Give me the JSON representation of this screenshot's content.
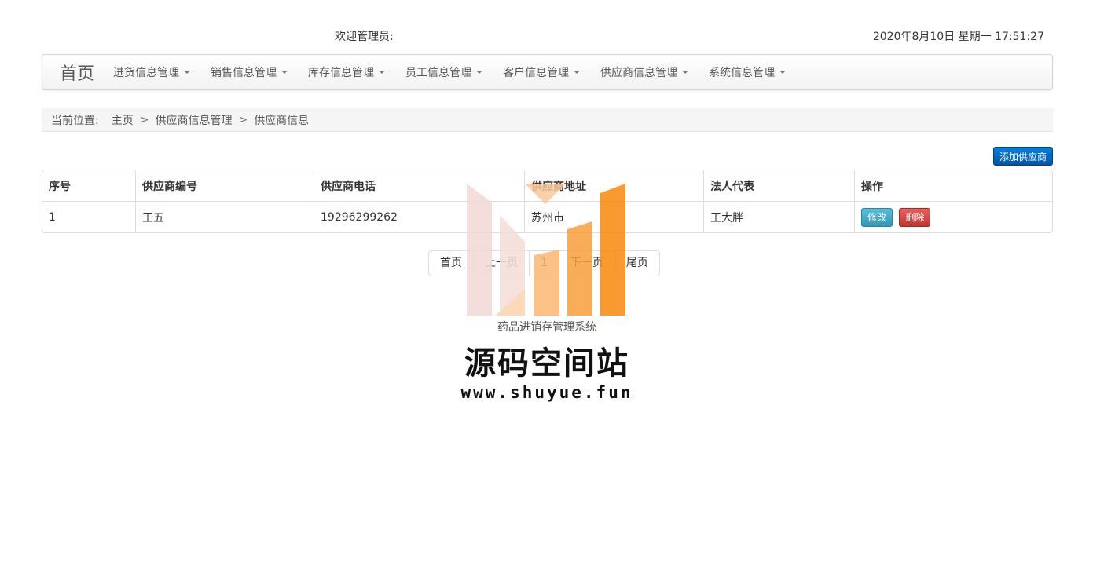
{
  "topbar": {
    "welcome": "欢迎管理员:",
    "datetime": "2020年8月10日 星期一 17:51:27"
  },
  "nav": {
    "brand": "首页",
    "items": [
      {
        "label": "进货信息管理"
      },
      {
        "label": "销售信息管理"
      },
      {
        "label": "库存信息管理"
      },
      {
        "label": "员工信息管理"
      },
      {
        "label": "客户信息管理"
      },
      {
        "label": "供应商信息管理"
      },
      {
        "label": "系统信息管理"
      }
    ]
  },
  "breadcrumb": {
    "label": "当前位置:",
    "items": [
      "主页",
      "供应商信息管理",
      "供应商信息"
    ],
    "separator": ">"
  },
  "actions": {
    "add_label": "添加供应商"
  },
  "table": {
    "headers": [
      "序号",
      "供应商编号",
      "供应商电话",
      "供应商地址",
      "法人代表",
      "操作"
    ],
    "rows": [
      {
        "no": "1",
        "code": "王五",
        "phone": "19296299262",
        "address": "苏州市",
        "legal": "王大胖"
      }
    ],
    "edit_label": "修改",
    "delete_label": "删除"
  },
  "pagination": {
    "first": "首页",
    "prev": "上一页",
    "current": "1",
    "next": "下一页",
    "last": "尾页"
  },
  "watermark": {
    "subtitle": "药品进销存管理系统",
    "title": "源码空间站",
    "url": "www.shuyue.fun"
  },
  "colors": {
    "primary_btn": "#0a6cc4",
    "info_btn": "#49afcd",
    "danger_btn": "#da4f49",
    "watermark_orange": "#f7890b"
  }
}
